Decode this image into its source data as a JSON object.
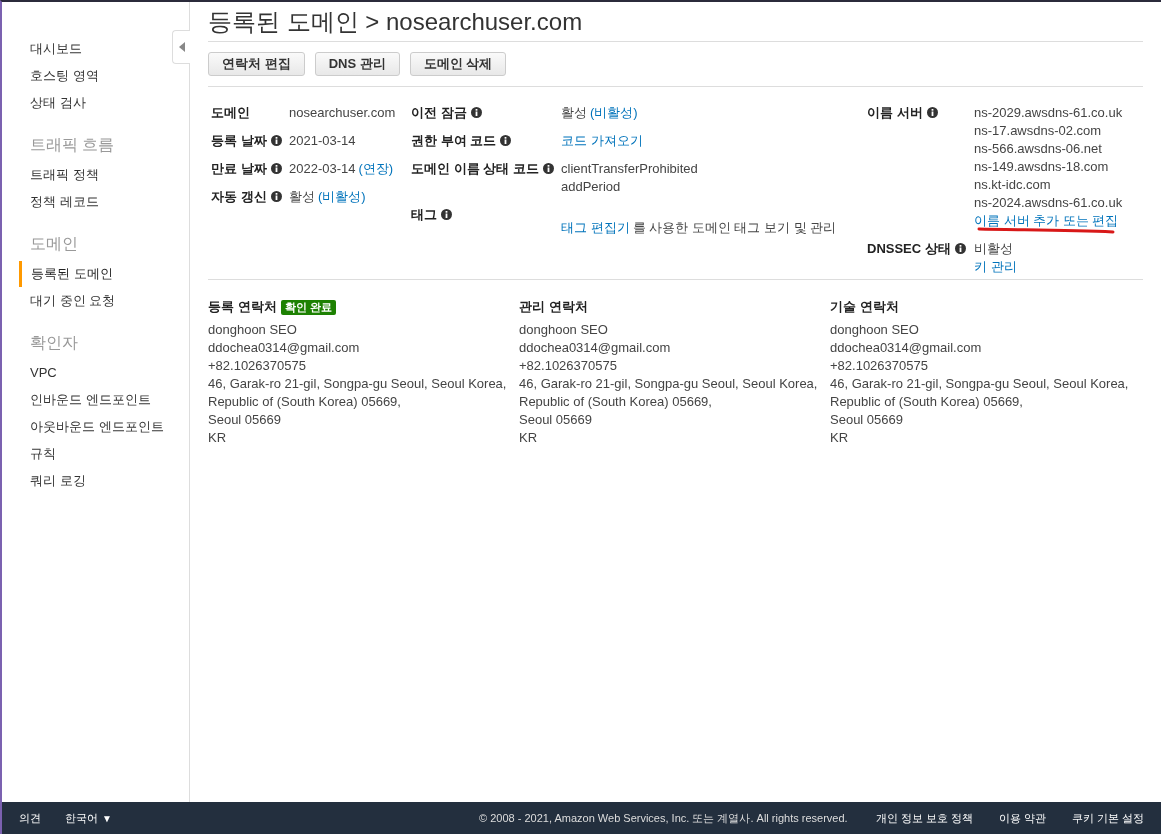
{
  "sidebar": {
    "groups": [
      {
        "items": [
          {
            "label": "대시보드",
            "selected": false
          },
          {
            "label": "호스팅 영역",
            "selected": false
          },
          {
            "label": "상태 검사",
            "selected": false
          }
        ]
      },
      {
        "heading": "트래픽 흐름",
        "items": [
          {
            "label": "트래픽 정책",
            "selected": false
          },
          {
            "label": "정책 레코드",
            "selected": false
          }
        ]
      },
      {
        "heading": "도메인",
        "items": [
          {
            "label": "등록된 도메인",
            "selected": true
          },
          {
            "label": "대기 중인 요청",
            "selected": false
          }
        ]
      },
      {
        "heading": "확인자",
        "items": [
          {
            "label": "VPC",
            "selected": false
          },
          {
            "label": "인바운드 엔드포인트",
            "selected": false
          },
          {
            "label": "아웃바운드 엔드포인트",
            "selected": false
          },
          {
            "label": "규칙",
            "selected": false
          },
          {
            "label": "쿼리 로깅",
            "selected": false
          }
        ]
      }
    ]
  },
  "page_title": "등록된 도메인 > nosearchuser.com",
  "buttons": [
    "연락처 편집",
    "DNS 관리",
    "도메인 삭제"
  ],
  "details": [
    [
      {
        "label": "도메인",
        "info": false,
        "lines": [
          [
            {
              "text": "nosearchuser.com",
              "link": false
            }
          ]
        ]
      },
      {
        "label": "등록 날짜",
        "info": true,
        "lines": [
          [
            {
              "text": "2021-03-14",
              "link": false
            }
          ]
        ]
      },
      {
        "label": "만료 날짜",
        "info": true,
        "lines": [
          [
            {
              "text": "2022-03-14",
              "link": false
            },
            {
              "text": "(연장)",
              "link": true
            }
          ]
        ]
      },
      {
        "label": "자동 갱신",
        "info": true,
        "lines": [
          [
            {
              "text": "활성",
              "link": false
            },
            {
              "text": "(비활성)",
              "link": true
            }
          ]
        ]
      }
    ],
    [
      {
        "label": "이전 잠금",
        "info": true,
        "lines": [
          [
            {
              "text": "활성",
              "link": false
            },
            {
              "text": "(비활성)",
              "link": true
            }
          ]
        ]
      },
      {
        "label": "권한 부여 코드",
        "info": true,
        "lines": [
          [
            {
              "text": "코드 가져오기",
              "link": true
            }
          ]
        ]
      },
      {
        "label": "도메인 이름 상태 코드",
        "info": true,
        "lines": [
          [
            {
              "text": "clientTransferProhibited",
              "link": false
            }
          ],
          [
            {
              "text": "addPeriod",
              "link": false
            }
          ]
        ]
      },
      {
        "label": "태그",
        "info": true,
        "lines": [
          [
            {
              "text": "태그 편집기",
              "link": true
            },
            {
              "text": "를 사용한 도메인 태그 보기 및 관리",
              "link": false
            }
          ]
        ]
      }
    ],
    [
      {
        "label": "이름 서버",
        "info": true,
        "lines": [
          [
            {
              "text": "ns-2029.awsdns-61.co.uk",
              "link": false
            }
          ],
          [
            {
              "text": "ns-17.awsdns-02.com",
              "link": false
            }
          ],
          [
            {
              "text": "ns-566.awsdns-06.net",
              "link": false
            }
          ],
          [
            {
              "text": "ns-149.awsdns-18.com",
              "link": false
            }
          ],
          [
            {
              "text": "ns.kt-idc.com",
              "link": false
            }
          ],
          [
            {
              "text": "ns-2024.awsdns-61.co.uk",
              "link": false
            }
          ],
          [
            {
              "text": "이름 서버 추가 또는 편집",
              "link": true
            }
          ]
        ]
      },
      {
        "label": "DNSSEC 상태",
        "info": true,
        "lines": [
          [
            {
              "text": "비활성",
              "link": false
            }
          ],
          [
            {
              "text": "키 관리",
              "link": true
            }
          ]
        ]
      }
    ]
  ],
  "contacts": [
    {
      "title": "등록 연락처",
      "badge": "확인 완료",
      "lines": [
        "donghoon SEO",
        "ddochea0314@gmail.com",
        "+82.1026370575",
        "46, Garak-ro 21-gil, Songpa-gu Seoul, Seoul Korea,",
        "Republic of (South Korea) 05669,",
        "Seoul 05669",
        "KR"
      ]
    },
    {
      "title": "관리 연락처",
      "lines": [
        "donghoon SEO",
        "ddochea0314@gmail.com",
        "+82.1026370575",
        "46, Garak-ro 21-gil, Songpa-gu Seoul, Seoul Korea,",
        "Republic of (South Korea) 05669,",
        "Seoul 05669",
        "KR"
      ]
    },
    {
      "title": "기술 연락처",
      "lines": [
        "donghoon SEO",
        "ddochea0314@gmail.com",
        "+82.1026370575",
        "46, Garak-ro 21-gil, Songpa-gu Seoul, Seoul Korea,",
        "Republic of (South Korea) 05669,",
        "Seoul 05669",
        "KR"
      ]
    }
  ],
  "footer": {
    "feedback": "의견",
    "language": "한국어",
    "language_caret": "▼",
    "copyright": "© 2008 - 2021, Amazon Web Services, Inc. 또는 계열사. All rights reserved.",
    "links": [
      "개인 정보 보호 정책",
      "이용 약관",
      "쿠키 기본 설정"
    ]
  }
}
